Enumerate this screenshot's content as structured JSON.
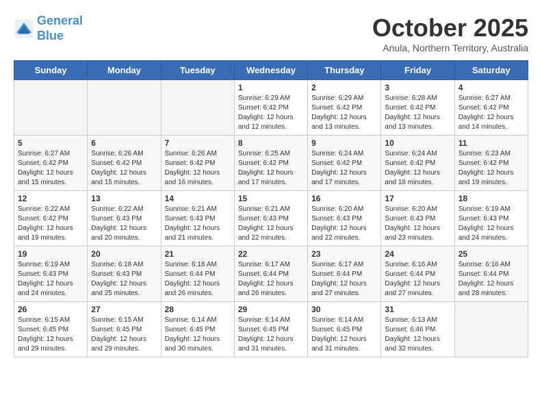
{
  "header": {
    "logo_line1": "General",
    "logo_line2": "Blue",
    "month": "October 2025",
    "location": "Anula, Northern Territory, Australia"
  },
  "weekdays": [
    "Sunday",
    "Monday",
    "Tuesday",
    "Wednesday",
    "Thursday",
    "Friday",
    "Saturday"
  ],
  "weeks": [
    [
      {
        "day": "",
        "info": ""
      },
      {
        "day": "",
        "info": ""
      },
      {
        "day": "",
        "info": ""
      },
      {
        "day": "1",
        "info": "Sunrise: 6:29 AM\nSunset: 6:42 PM\nDaylight: 12 hours\nand 12 minutes."
      },
      {
        "day": "2",
        "info": "Sunrise: 6:29 AM\nSunset: 6:42 PM\nDaylight: 12 hours\nand 13 minutes."
      },
      {
        "day": "3",
        "info": "Sunrise: 6:28 AM\nSunset: 6:42 PM\nDaylight: 12 hours\nand 13 minutes."
      },
      {
        "day": "4",
        "info": "Sunrise: 6:27 AM\nSunset: 6:42 PM\nDaylight: 12 hours\nand 14 minutes."
      }
    ],
    [
      {
        "day": "5",
        "info": "Sunrise: 6:27 AM\nSunset: 6:42 PM\nDaylight: 12 hours\nand 15 minutes."
      },
      {
        "day": "6",
        "info": "Sunrise: 6:26 AM\nSunset: 6:42 PM\nDaylight: 12 hours\nand 15 minutes."
      },
      {
        "day": "7",
        "info": "Sunrise: 6:26 AM\nSunset: 6:42 PM\nDaylight: 12 hours\nand 16 minutes."
      },
      {
        "day": "8",
        "info": "Sunrise: 6:25 AM\nSunset: 6:42 PM\nDaylight: 12 hours\nand 17 minutes."
      },
      {
        "day": "9",
        "info": "Sunrise: 6:24 AM\nSunset: 6:42 PM\nDaylight: 12 hours\nand 17 minutes."
      },
      {
        "day": "10",
        "info": "Sunrise: 6:24 AM\nSunset: 6:42 PM\nDaylight: 12 hours\nand 18 minutes."
      },
      {
        "day": "11",
        "info": "Sunrise: 6:23 AM\nSunset: 6:42 PM\nDaylight: 12 hours\nand 19 minutes."
      }
    ],
    [
      {
        "day": "12",
        "info": "Sunrise: 6:22 AM\nSunset: 6:42 PM\nDaylight: 12 hours\nand 19 minutes."
      },
      {
        "day": "13",
        "info": "Sunrise: 6:22 AM\nSunset: 6:43 PM\nDaylight: 12 hours\nand 20 minutes."
      },
      {
        "day": "14",
        "info": "Sunrise: 6:21 AM\nSunset: 6:43 PM\nDaylight: 12 hours\nand 21 minutes."
      },
      {
        "day": "15",
        "info": "Sunrise: 6:21 AM\nSunset: 6:43 PM\nDaylight: 12 hours\nand 22 minutes."
      },
      {
        "day": "16",
        "info": "Sunrise: 6:20 AM\nSunset: 6:43 PM\nDaylight: 12 hours\nand 22 minutes."
      },
      {
        "day": "17",
        "info": "Sunrise: 6:20 AM\nSunset: 6:43 PM\nDaylight: 12 hours\nand 23 minutes."
      },
      {
        "day": "18",
        "info": "Sunrise: 6:19 AM\nSunset: 6:43 PM\nDaylight: 12 hours\nand 24 minutes."
      }
    ],
    [
      {
        "day": "19",
        "info": "Sunrise: 6:19 AM\nSunset: 6:43 PM\nDaylight: 12 hours\nand 24 minutes."
      },
      {
        "day": "20",
        "info": "Sunrise: 6:18 AM\nSunset: 6:43 PM\nDaylight: 12 hours\nand 25 minutes."
      },
      {
        "day": "21",
        "info": "Sunrise: 6:18 AM\nSunset: 6:44 PM\nDaylight: 12 hours\nand 26 minutes."
      },
      {
        "day": "22",
        "info": "Sunrise: 6:17 AM\nSunset: 6:44 PM\nDaylight: 12 hours\nand 26 minutes."
      },
      {
        "day": "23",
        "info": "Sunrise: 6:17 AM\nSunset: 6:44 PM\nDaylight: 12 hours\nand 27 minutes."
      },
      {
        "day": "24",
        "info": "Sunrise: 6:16 AM\nSunset: 6:44 PM\nDaylight: 12 hours\nand 27 minutes."
      },
      {
        "day": "25",
        "info": "Sunrise: 6:16 AM\nSunset: 6:44 PM\nDaylight: 12 hours\nand 28 minutes."
      }
    ],
    [
      {
        "day": "26",
        "info": "Sunrise: 6:15 AM\nSunset: 6:45 PM\nDaylight: 12 hours\nand 29 minutes."
      },
      {
        "day": "27",
        "info": "Sunrise: 6:15 AM\nSunset: 6:45 PM\nDaylight: 12 hours\nand 29 minutes."
      },
      {
        "day": "28",
        "info": "Sunrise: 6:14 AM\nSunset: 6:45 PM\nDaylight: 12 hours\nand 30 minutes."
      },
      {
        "day": "29",
        "info": "Sunrise: 6:14 AM\nSunset: 6:45 PM\nDaylight: 12 hours\nand 31 minutes."
      },
      {
        "day": "30",
        "info": "Sunrise: 6:14 AM\nSunset: 6:45 PM\nDaylight: 12 hours\nand 31 minutes."
      },
      {
        "day": "31",
        "info": "Sunrise: 6:13 AM\nSunset: 6:46 PM\nDaylight: 12 hours\nand 32 minutes."
      },
      {
        "day": "",
        "info": ""
      }
    ]
  ]
}
